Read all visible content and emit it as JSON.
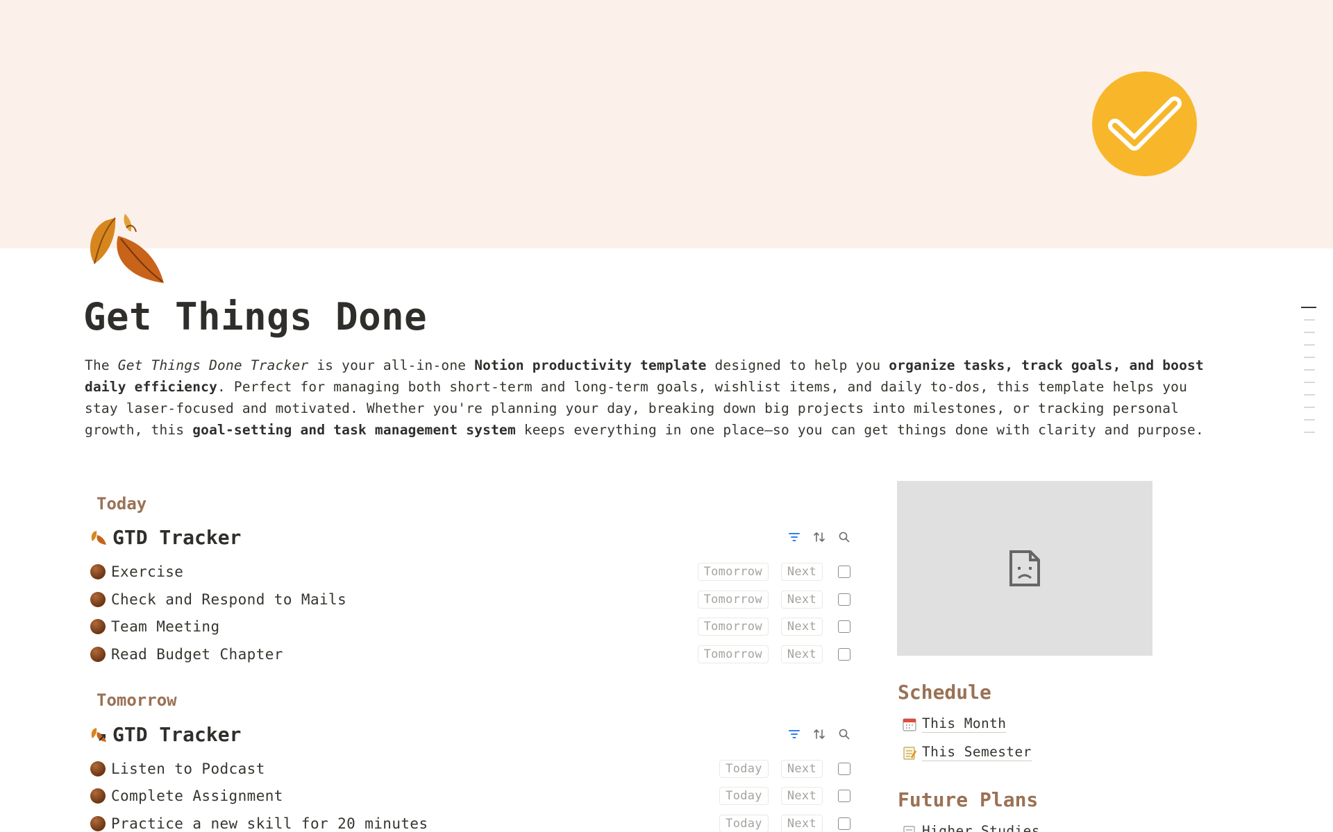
{
  "page": {
    "title": "Get Things Done",
    "intro": {
      "p1": "The ",
      "italic1": "Get Things Done Tracker",
      "p2": " is your all-in-one ",
      "bold1": "Notion productivity template",
      "p3": " designed to help you ",
      "bold2": "organize tasks, track goals, and boost daily efficiency",
      "p4": ". Perfect for managing both short-term and long-term goals, wishlist items, and daily to-dos, this template helps you stay laser-focused and motivated. Whether you're planning your day, breaking down big projects into milestones, or tracking personal growth, this ",
      "bold3": "goal-setting and task management system",
      "p5": " keeps everything in one place—so you can get things done with clarity and purpose."
    }
  },
  "icons": {
    "cover_badge": "checkmark-badge-icon",
    "page_icon": "autumn-leaves-icon",
    "filter": "filter-icon",
    "sort": "sort-icon",
    "search": "search-icon",
    "task_dot": "brown-circle-icon",
    "image_broken": "broken-image-icon",
    "calendar": "calendar-icon",
    "memo": "memo-icon"
  },
  "colors": {
    "cover": "#fbf1ea",
    "badge": "#f8b62b",
    "accent_brown": "#9a7155",
    "filter_blue": "#2f80ed"
  },
  "today": {
    "label": "Today",
    "tracker_title": "GTD Tracker",
    "tasks": [
      {
        "name": "Exercise",
        "move": "Tomorrow",
        "next": "Next"
      },
      {
        "name": "Check and Respond to Mails",
        "move": "Tomorrow",
        "next": "Next"
      },
      {
        "name": "Team Meeting",
        "move": "Tomorrow",
        "next": "Next"
      },
      {
        "name": "Read Budget Chapter",
        "move": "Tomorrow",
        "next": "Next"
      }
    ]
  },
  "tomorrow": {
    "label": "Tomorrow",
    "tracker_title": "GTD Tracker",
    "tasks": [
      {
        "name": "Listen to Podcast",
        "move": "Today",
        "next": "Next"
      },
      {
        "name": "Complete Assignment",
        "move": "Today",
        "next": "Next"
      },
      {
        "name": "Practice a new skill for 20 minutes",
        "move": "Today",
        "next": "Next"
      }
    ]
  },
  "sidebar": {
    "schedule_heading": "Schedule",
    "schedule_links": [
      "This Month",
      "This Semester"
    ],
    "future_heading": "Future Plans",
    "future_links": [
      "Higher Studies"
    ]
  }
}
